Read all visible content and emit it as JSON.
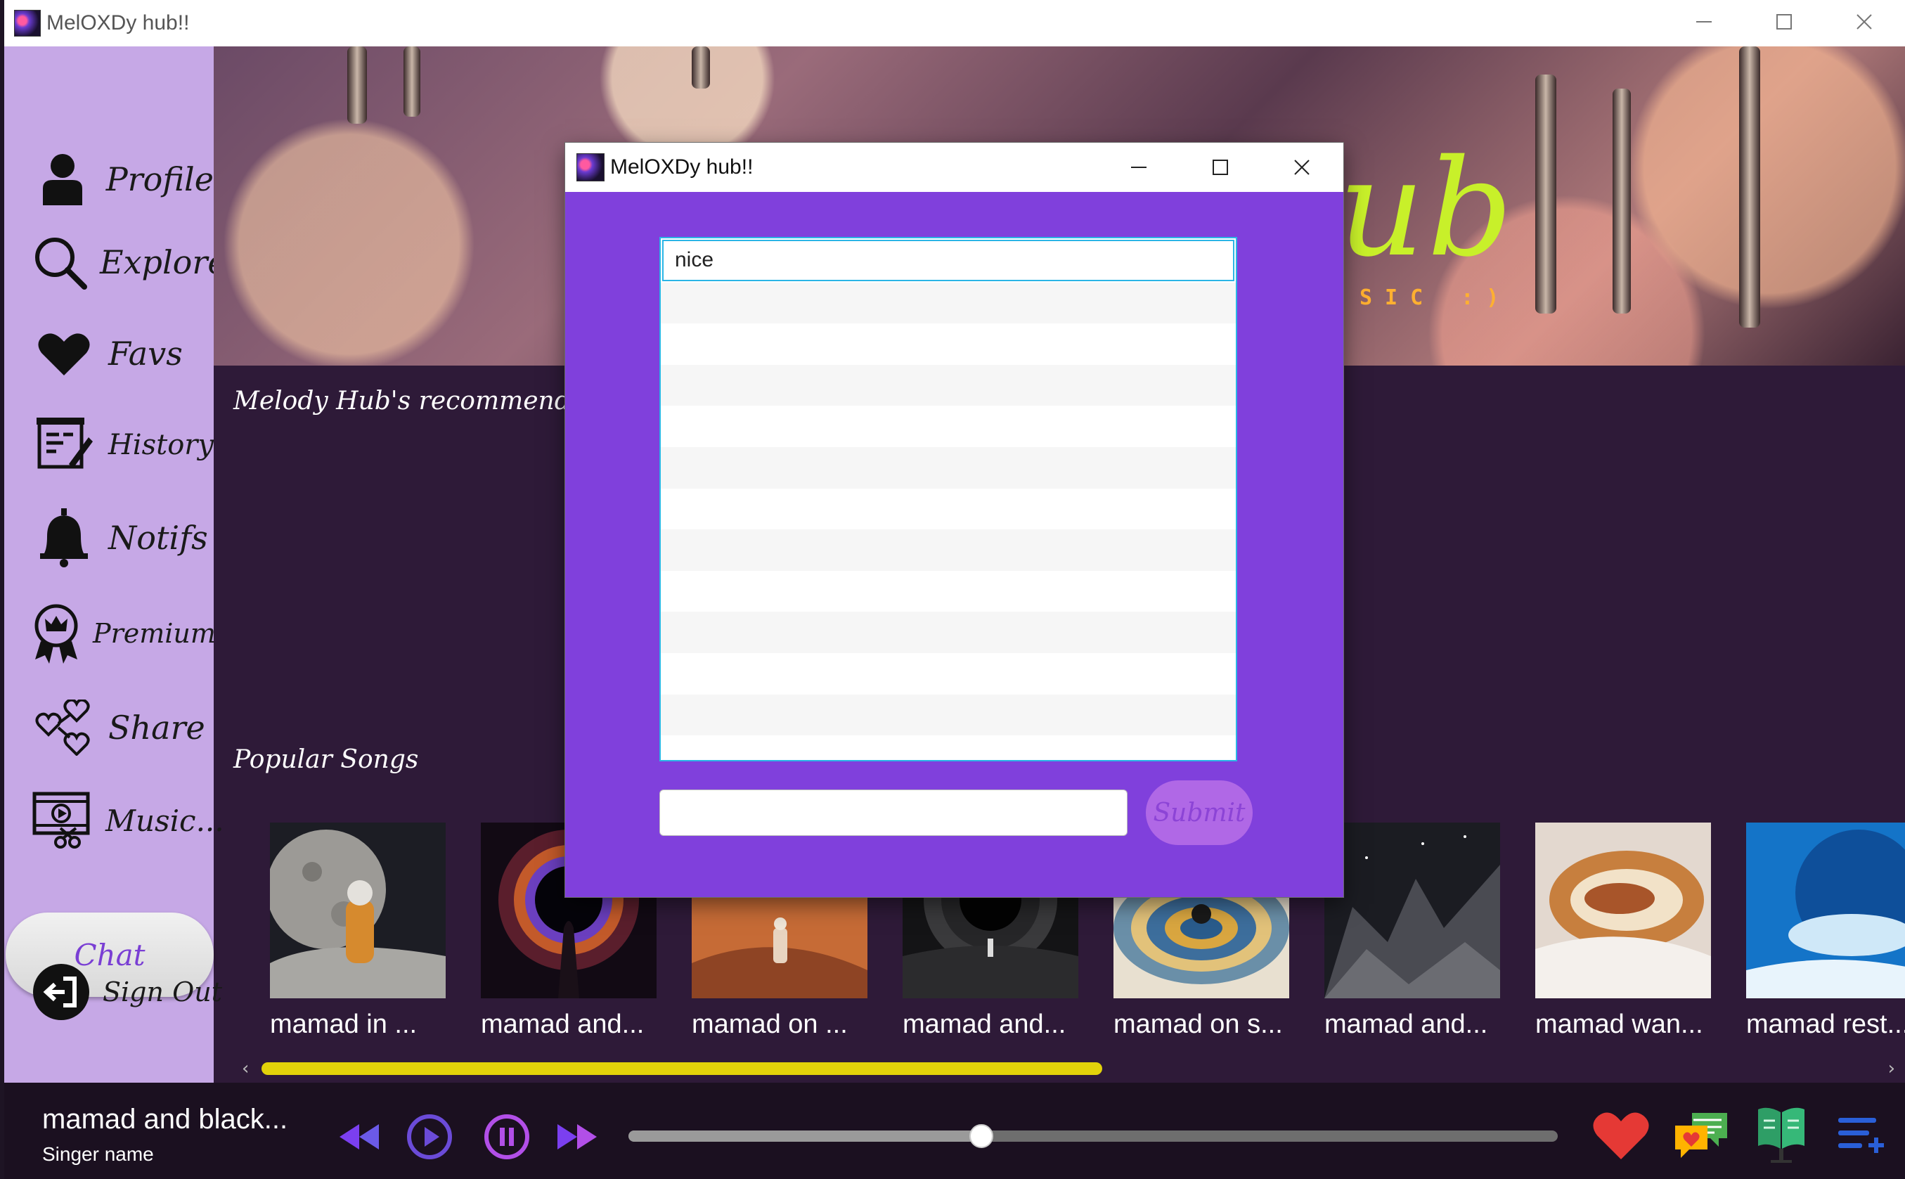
{
  "app": {
    "title": "MelOXDy hub!!",
    "window_controls": {
      "minimize": "—",
      "maximize": "☐",
      "close": "✕"
    }
  },
  "sidebar": {
    "items": [
      {
        "label": "Profile",
        "icon": "user-icon"
      },
      {
        "label": "Explore",
        "icon": "search-icon"
      },
      {
        "label": "Favs",
        "icon": "heart-icon"
      },
      {
        "label": "History",
        "icon": "history-icon"
      },
      {
        "label": "Notifs",
        "icon": "bell-icon"
      },
      {
        "label": "Premium",
        "icon": "premium-badge-icon"
      },
      {
        "label": "Share",
        "icon": "share-hearts-icon"
      },
      {
        "label": "Music...",
        "icon": "music-video-icon"
      }
    ],
    "chat_label": "Chat",
    "signout_label": "Sign Out"
  },
  "banner": {
    "script_text": "ub",
    "subtitle": "SIC :)"
  },
  "main": {
    "recommendations_title": "Melody Hub's recommendations to yo",
    "popular_title": "Popular Songs",
    "songs": [
      {
        "title": "mamad in ..."
      },
      {
        "title": "mamad and..."
      },
      {
        "title": "mamad on ..."
      },
      {
        "title": "mamad and..."
      },
      {
        "title": "mamad on s..."
      },
      {
        "title": "mamad and..."
      },
      {
        "title": "mamad wan..."
      },
      {
        "title": "mamad rest..."
      }
    ],
    "scroll_left": "‹",
    "scroll_right": "›"
  },
  "player": {
    "song_title": "mamad and black...",
    "artist": "Singer name",
    "progress_fraction": 0.38,
    "accent_colors": {
      "rewind": "#7b3ff0",
      "play": "#6b4bd8",
      "pause": "#b24fe8",
      "heart": "#e53935"
    }
  },
  "dialog": {
    "title": "MelOXDy hub!!",
    "messages": [
      "nice"
    ],
    "input_value": "",
    "submit_label": "Submit"
  }
}
